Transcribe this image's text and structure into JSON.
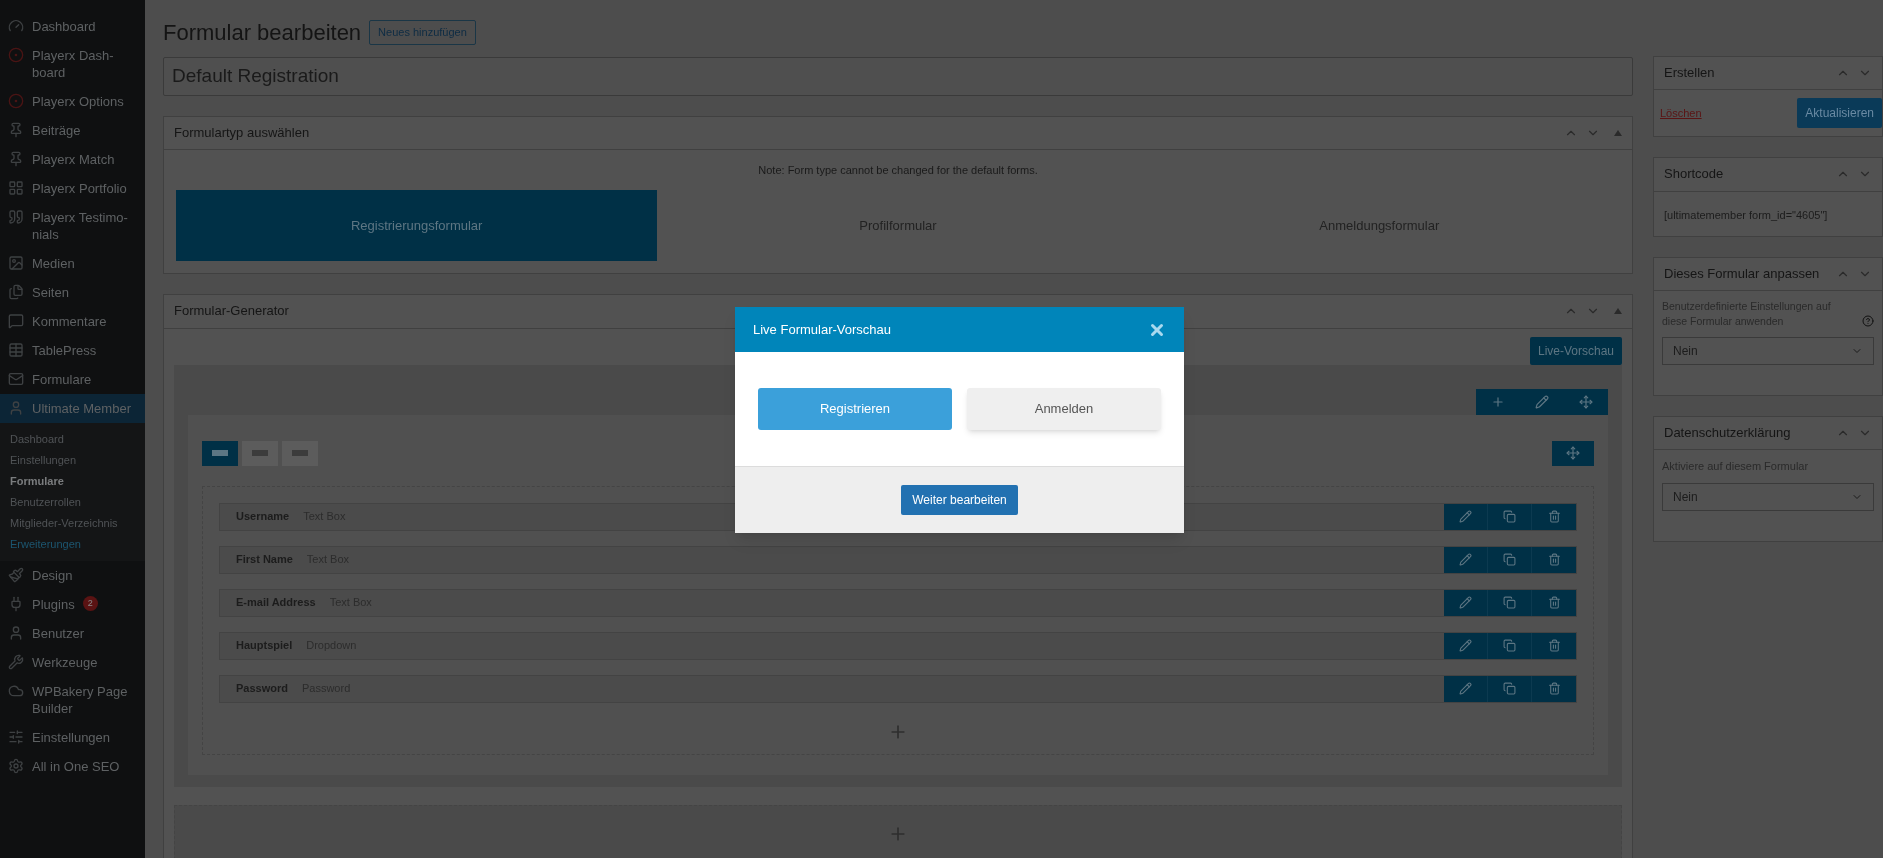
{
  "sidebar": {
    "items": [
      {
        "label": "Dashboard",
        "selected": false
      },
      {
        "label": "Playerx Dash-board",
        "selected": false
      },
      {
        "label": "Playerx Options",
        "selected": false
      },
      {
        "label": "Beiträge",
        "selected": false
      },
      {
        "label": "Playerx Match",
        "selected": false
      },
      {
        "label": "Playerx Portfolio",
        "selected": false
      },
      {
        "label": "Playerx Testimo-nials",
        "selected": false
      },
      {
        "label": "Medien",
        "selected": false
      },
      {
        "label": "Seiten",
        "selected": false
      },
      {
        "label": "Kommentare",
        "selected": false
      },
      {
        "label": "TablePress",
        "selected": false
      },
      {
        "label": "Formulare",
        "selected": false
      },
      {
        "label": "Ultimate Member",
        "selected": true,
        "children": [
          {
            "label": "Dashboard",
            "selected": false,
            "kind": "normal"
          },
          {
            "label": "Einstellungen",
            "selected": false,
            "kind": "normal"
          },
          {
            "label": "Formulare",
            "selected": true,
            "kind": "normal"
          },
          {
            "label": "Benutzerrollen",
            "selected": false,
            "kind": "normal"
          },
          {
            "label": "Mitglieder-Verzeichnis",
            "selected": false,
            "kind": "normal"
          },
          {
            "label": "Erweiterungen",
            "selected": false,
            "kind": "highlight"
          }
        ]
      },
      {
        "label": "Design",
        "selected": false
      },
      {
        "label": "Plugins",
        "selected": false,
        "badge": "2"
      },
      {
        "label": "Benutzer",
        "selected": false
      },
      {
        "label": "Werkzeuge",
        "selected": false
      },
      {
        "label": "WPBakery Page Builder",
        "selected": false
      },
      {
        "label": "Einstellungen",
        "selected": false
      },
      {
        "label": "All in One SEO",
        "selected": false
      }
    ]
  },
  "header": {
    "title": "Formular bearbeiten",
    "add_button": "Neues hinzufügen"
  },
  "form_title": {
    "value": "Default Registration"
  },
  "form_type_panel": {
    "title": "Formulartyp auswählen",
    "note": "Note: Form type cannot be changed for the default forms.",
    "tabs": [
      {
        "label": "Registrierungsformular",
        "selected": true
      },
      {
        "label": "Profilformular",
        "selected": false
      },
      {
        "label": "Anmeldungsformular",
        "selected": false
      }
    ]
  },
  "builder_panel": {
    "title": "Formular-Generator",
    "preview_button": "Live-Vorschau",
    "column_tabs": [
      {
        "selected": true
      },
      {
        "selected": false
      },
      {
        "selected": false
      }
    ],
    "fields": [
      {
        "label": "Username",
        "type": "Text Box"
      },
      {
        "label": "First Name",
        "type": "Text Box"
      },
      {
        "label": "E-mail Address",
        "type": "Text Box"
      },
      {
        "label": "Hauptspiel",
        "type": "Dropdown"
      },
      {
        "label": "Password",
        "type": "Password"
      }
    ]
  },
  "right_panels": {
    "publish": {
      "title": "Erstellen",
      "delete_link": "Löschen",
      "update_button": "Aktualisieren"
    },
    "shortcode": {
      "title": "Shortcode",
      "code": "[ultimatemember form_id=\"4605\"]"
    },
    "customize": {
      "title": "Dieses Formular anpassen",
      "label": "Benutzerdefinierte Einstellungen auf diese Formular anwenden",
      "value": "Nein"
    },
    "privacy": {
      "title": "Datenschutzerklärung",
      "label": "Aktiviere auf diesem Formular",
      "value": "Nein"
    }
  },
  "modal": {
    "title": "Live Formular-Vorschau",
    "tabs": [
      {
        "label": "Registrieren",
        "selected": true
      },
      {
        "label": "Anmelden",
        "selected": false
      }
    ],
    "footer_button": "Weiter bearbeiten"
  }
}
